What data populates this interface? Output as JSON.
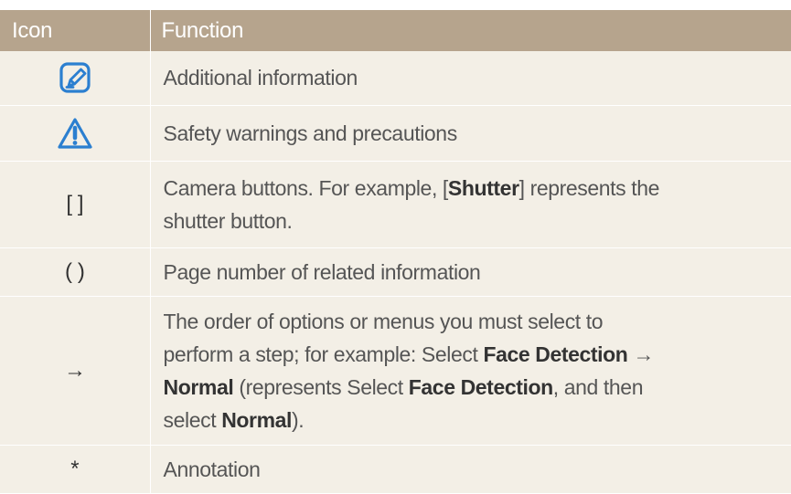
{
  "header": {
    "icon_col": "Icon",
    "function_col": "Function"
  },
  "rows": [
    {
      "icon": "note-icon",
      "description": "Additional information"
    },
    {
      "icon": "warning-icon",
      "description": "Safety warnings and precautions"
    },
    {
      "symbol": "[ ]",
      "line1_a": "Camera buttons. For example, [",
      "line1_b": "Shutter",
      "line1_c": "] represents the",
      "line2": "shutter button."
    },
    {
      "symbol": "( )",
      "description": "Page number of related information"
    },
    {
      "symbol": "→",
      "line1": "The order of options or menus you must select to",
      "line2_a": "perform a step; for example: Select ",
      "line2_b": "Face Detection",
      "line2_c": " →",
      "line3_a": "Normal",
      "line3_b": " (represents Select ",
      "line3_c": "Face Detection",
      "line3_d": ", and then",
      "line4_a": "select ",
      "line4_b": "Normal",
      "line4_c": ")."
    },
    {
      "symbol": "*",
      "description": "Annotation"
    }
  ],
  "colors": {
    "header_bg": "#b6a48d",
    "row_bg": "#f3efe6",
    "icon_blue": "#2b7fd0"
  }
}
